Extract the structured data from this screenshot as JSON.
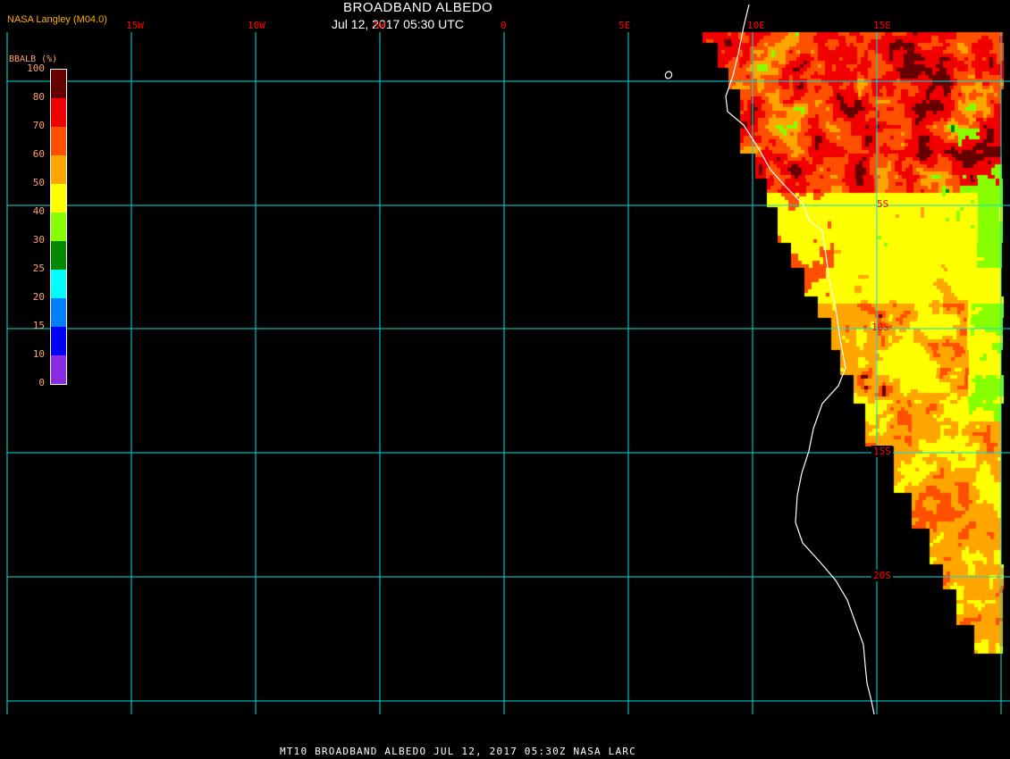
{
  "header": {
    "title": "BROADBAND ALBEDO",
    "datetime": "Jul 12, 2017 05:30 UTC",
    "organization": "NASA Langley (M04.0)"
  },
  "longitude_labels": [
    "15W",
    "10W",
    "5W",
    "0",
    "5E",
    "10E",
    "15E"
  ],
  "latitude_labels": [
    "5S",
    "10S",
    "15S",
    "20S"
  ],
  "legend": {
    "unit": "BBALB (%)",
    "ticks": [
      "100",
      "80",
      "70",
      "60",
      "50",
      "40",
      "30",
      "25",
      "20",
      "15",
      "10",
      "0"
    ],
    "colors": [
      "#660000",
      "#f00000",
      "#ff5000",
      "#ffa500",
      "#ffff00",
      "#88ff00",
      "#008800",
      "#00ffff",
      "#0080ff",
      "#0000ff",
      "#8a2be2"
    ]
  },
  "footer": "MT10  BROADBAND ALBEDO   JUL 12, 2017 05:30Z   NASA LARC",
  "colors": {
    "grid": "#00e0e0",
    "coast": "#ffffff",
    "label": "#ff0000"
  }
}
